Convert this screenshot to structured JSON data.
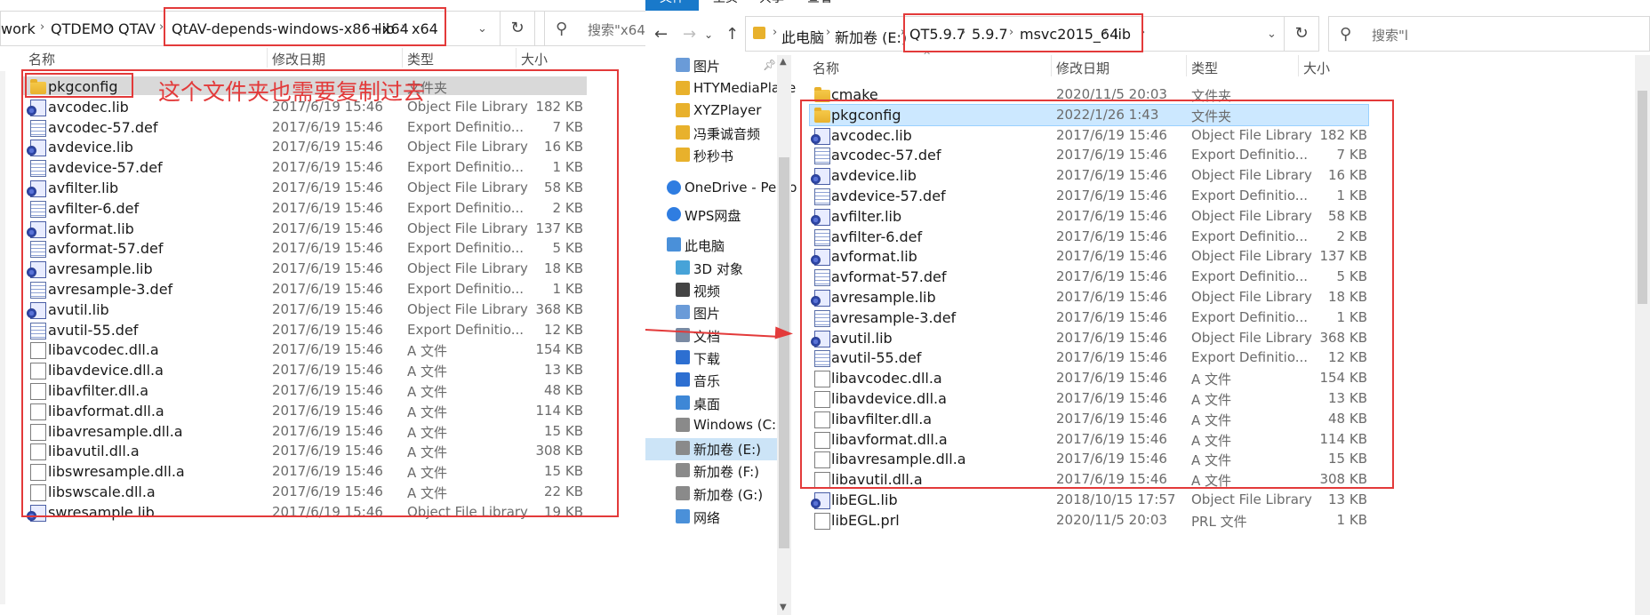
{
  "left": {
    "breadcrumbs": [
      "work",
      "QTDEMO",
      "QTAV",
      "QtAV-depends-windows-x86+x64",
      "lib",
      "x64"
    ],
    "search_placeholder": "搜索\"x64\"",
    "columns": {
      "name": "名称",
      "date": "修改日期",
      "type": "类型",
      "size": "大小"
    },
    "note": "这个文件夹也需要复制过去",
    "files": [
      {
        "name": "pkgconfig",
        "date": "",
        "type": "文件夹",
        "size": "",
        "icon": "folder"
      },
      {
        "name": "avcodec.lib",
        "date": "2017/6/19 15:46",
        "type": "Object File Library",
        "size": "182 KB",
        "icon": "lib"
      },
      {
        "name": "avcodec-57.def",
        "date": "2017/6/19 15:46",
        "type": "Export Definitio...",
        "size": "7 KB",
        "icon": "def"
      },
      {
        "name": "avdevice.lib",
        "date": "2017/6/19 15:46",
        "type": "Object File Library",
        "size": "16 KB",
        "icon": "lib"
      },
      {
        "name": "avdevice-57.def",
        "date": "2017/6/19 15:46",
        "type": "Export Definitio...",
        "size": "1 KB",
        "icon": "def"
      },
      {
        "name": "avfilter.lib",
        "date": "2017/6/19 15:46",
        "type": "Object File Library",
        "size": "58 KB",
        "icon": "lib"
      },
      {
        "name": "avfilter-6.def",
        "date": "2017/6/19 15:46",
        "type": "Export Definitio...",
        "size": "2 KB",
        "icon": "def"
      },
      {
        "name": "avformat.lib",
        "date": "2017/6/19 15:46",
        "type": "Object File Library",
        "size": "137 KB",
        "icon": "lib"
      },
      {
        "name": "avformat-57.def",
        "date": "2017/6/19 15:46",
        "type": "Export Definitio...",
        "size": "5 KB",
        "icon": "def"
      },
      {
        "name": "avresample.lib",
        "date": "2017/6/19 15:46",
        "type": "Object File Library",
        "size": "18 KB",
        "icon": "lib"
      },
      {
        "name": "avresample-3.def",
        "date": "2017/6/19 15:46",
        "type": "Export Definitio...",
        "size": "1 KB",
        "icon": "def"
      },
      {
        "name": "avutil.lib",
        "date": "2017/6/19 15:46",
        "type": "Object File Library",
        "size": "368 KB",
        "icon": "lib"
      },
      {
        "name": "avutil-55.def",
        "date": "2017/6/19 15:46",
        "type": "Export Definitio...",
        "size": "12 KB",
        "icon": "def"
      },
      {
        "name": "libavcodec.dll.a",
        "date": "2017/6/19 15:46",
        "type": "A 文件",
        "size": "154 KB",
        "icon": "doc"
      },
      {
        "name": "libavdevice.dll.a",
        "date": "2017/6/19 15:46",
        "type": "A 文件",
        "size": "13 KB",
        "icon": "doc"
      },
      {
        "name": "libavfilter.dll.a",
        "date": "2017/6/19 15:46",
        "type": "A 文件",
        "size": "48 KB",
        "icon": "doc"
      },
      {
        "name": "libavformat.dll.a",
        "date": "2017/6/19 15:46",
        "type": "A 文件",
        "size": "114 KB",
        "icon": "doc"
      },
      {
        "name": "libavresample.dll.a",
        "date": "2017/6/19 15:46",
        "type": "A 文件",
        "size": "15 KB",
        "icon": "doc"
      },
      {
        "name": "libavutil.dll.a",
        "date": "2017/6/19 15:46",
        "type": "A 文件",
        "size": "308 KB",
        "icon": "doc"
      },
      {
        "name": "libswresample.dll.a",
        "date": "2017/6/19 15:46",
        "type": "A 文件",
        "size": "15 KB",
        "icon": "doc"
      },
      {
        "name": "libswscale.dll.a",
        "date": "2017/6/19 15:46",
        "type": "A 文件",
        "size": "22 KB",
        "icon": "doc"
      },
      {
        "name": "swresample.lib",
        "date": "2017/6/19 15:46",
        "type": "Object File Library",
        "size": "19 KB",
        "icon": "lib"
      }
    ]
  },
  "right": {
    "ribbon_tabs": [
      "文件",
      "主页",
      "共享",
      "查看"
    ],
    "breadcrumbs": [
      "此电脑",
      "新加卷 (E:)",
      "QT5.9.7",
      "5.9.7",
      "msvc2015_64",
      "lib"
    ],
    "search_placeholder": "搜索\"l",
    "columns": {
      "name": "名称",
      "date": "修改日期",
      "type": "类型",
      "size": "大小"
    },
    "nav": [
      {
        "label": "图片",
        "icon": "picture"
      },
      {
        "label": "HTYMediaPlaye",
        "icon": "folder"
      },
      {
        "label": "XYZPlayer",
        "icon": "folder"
      },
      {
        "label": "冯秉诚音频",
        "icon": "folder"
      },
      {
        "label": "秒秒书",
        "icon": "folder"
      },
      {
        "label": "OneDrive - Perso",
        "icon": "cloud"
      },
      {
        "label": "WPS网盘",
        "icon": "cloud"
      },
      {
        "label": "此电脑",
        "icon": "pc"
      },
      {
        "label": "3D 对象",
        "icon": "cube"
      },
      {
        "label": "视频",
        "icon": "video"
      },
      {
        "label": "图片",
        "icon": "picture"
      },
      {
        "label": "文档",
        "icon": "document"
      },
      {
        "label": "下载",
        "icon": "download"
      },
      {
        "label": "音乐",
        "icon": "music"
      },
      {
        "label": "桌面",
        "icon": "desktop"
      },
      {
        "label": "Windows (C:)",
        "icon": "drive"
      },
      {
        "label": "新加卷 (E:)",
        "icon": "drive"
      },
      {
        "label": "新加卷 (F:)",
        "icon": "drive"
      },
      {
        "label": "新加卷 (G:)",
        "icon": "drive"
      },
      {
        "label": "网络",
        "icon": "network"
      }
    ],
    "files": [
      {
        "name": "cmake",
        "date": "2020/11/5 20:03",
        "type": "文件夹",
        "size": "",
        "icon": "folder"
      },
      {
        "name": "pkgconfig",
        "date": "2022/1/26 1:43",
        "type": "文件夹",
        "size": "",
        "icon": "folder"
      },
      {
        "name": "avcodec.lib",
        "date": "2017/6/19 15:46",
        "type": "Object File Library",
        "size": "182 KB",
        "icon": "lib"
      },
      {
        "name": "avcodec-57.def",
        "date": "2017/6/19 15:46",
        "type": "Export Definitio...",
        "size": "7 KB",
        "icon": "def"
      },
      {
        "name": "avdevice.lib",
        "date": "2017/6/19 15:46",
        "type": "Object File Library",
        "size": "16 KB",
        "icon": "lib"
      },
      {
        "name": "avdevice-57.def",
        "date": "2017/6/19 15:46",
        "type": "Export Definitio...",
        "size": "1 KB",
        "icon": "def"
      },
      {
        "name": "avfilter.lib",
        "date": "2017/6/19 15:46",
        "type": "Object File Library",
        "size": "58 KB",
        "icon": "lib"
      },
      {
        "name": "avfilter-6.def",
        "date": "2017/6/19 15:46",
        "type": "Export Definitio...",
        "size": "2 KB",
        "icon": "def"
      },
      {
        "name": "avformat.lib",
        "date": "2017/6/19 15:46",
        "type": "Object File Library",
        "size": "137 KB",
        "icon": "lib"
      },
      {
        "name": "avformat-57.def",
        "date": "2017/6/19 15:46",
        "type": "Export Definitio...",
        "size": "5 KB",
        "icon": "def"
      },
      {
        "name": "avresample.lib",
        "date": "2017/6/19 15:46",
        "type": "Object File Library",
        "size": "18 KB",
        "icon": "lib"
      },
      {
        "name": "avresample-3.def",
        "date": "2017/6/19 15:46",
        "type": "Export Definitio...",
        "size": "1 KB",
        "icon": "def"
      },
      {
        "name": "avutil.lib",
        "date": "2017/6/19 15:46",
        "type": "Object File Library",
        "size": "368 KB",
        "icon": "lib"
      },
      {
        "name": "avutil-55.def",
        "date": "2017/6/19 15:46",
        "type": "Export Definitio...",
        "size": "12 KB",
        "icon": "def"
      },
      {
        "name": "libavcodec.dll.a",
        "date": "2017/6/19 15:46",
        "type": "A 文件",
        "size": "154 KB",
        "icon": "doc"
      },
      {
        "name": "libavdevice.dll.a",
        "date": "2017/6/19 15:46",
        "type": "A 文件",
        "size": "13 KB",
        "icon": "doc"
      },
      {
        "name": "libavfilter.dll.a",
        "date": "2017/6/19 15:46",
        "type": "A 文件",
        "size": "48 KB",
        "icon": "doc"
      },
      {
        "name": "libavformat.dll.a",
        "date": "2017/6/19 15:46",
        "type": "A 文件",
        "size": "114 KB",
        "icon": "doc"
      },
      {
        "name": "libavresample.dll.a",
        "date": "2017/6/19 15:46",
        "type": "A 文件",
        "size": "15 KB",
        "icon": "doc"
      },
      {
        "name": "libavutil.dll.a",
        "date": "2017/6/19 15:46",
        "type": "A 文件",
        "size": "308 KB",
        "icon": "doc"
      },
      {
        "name": "libEGL.lib",
        "date": "2018/10/15 17:57",
        "type": "Object File Library",
        "size": "13 KB",
        "icon": "lib"
      },
      {
        "name": "libEGL.prl",
        "date": "2020/11/5 20:03",
        "type": "PRL 文件",
        "size": "1 KB",
        "icon": "doc"
      }
    ]
  },
  "colors": {
    "annotation_red": "#e33a3a",
    "selection_blue": "#cce8ff",
    "ribbon_blue": "#1979ca"
  }
}
